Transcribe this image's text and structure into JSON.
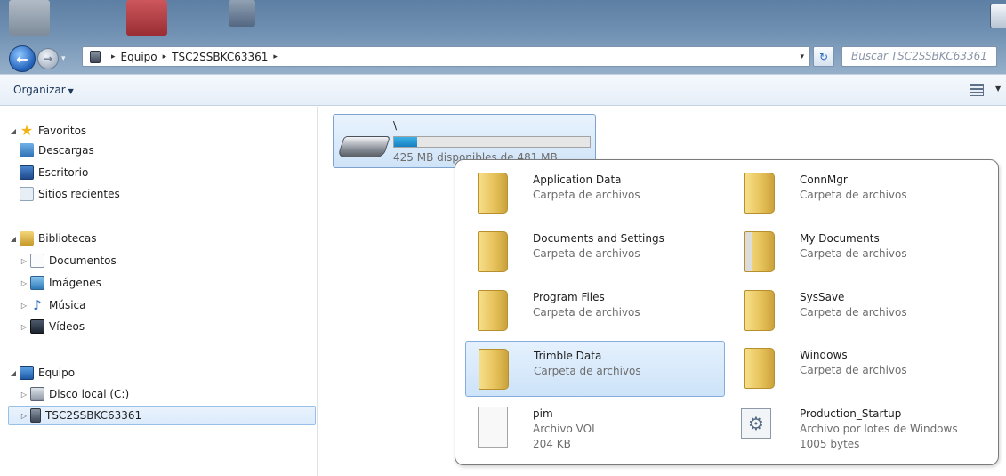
{
  "address_bar": {
    "crumbs": [
      "Equipo",
      "TSC2SSBKC63361"
    ],
    "search_placeholder": "Buscar TSC2SSBKC63361"
  },
  "toolbar": {
    "organize_label": "Organizar"
  },
  "nav_pane": {
    "favorites": {
      "label": "Favoritos",
      "items": [
        "Descargas",
        "Escritorio",
        "Sitios recientes"
      ]
    },
    "libraries": {
      "label": "Bibliotecas",
      "items": [
        "Documentos",
        "Imágenes",
        "Música",
        "Vídeos"
      ]
    },
    "computer": {
      "label": "Equipo",
      "items": [
        "Disco local (C:)",
        "TSC2SSBKC63361"
      ]
    }
  },
  "drive": {
    "name": "\\",
    "free_text": "425 MB disponibles de 481 MB",
    "used_fraction": 0.116
  },
  "popup_items": [
    {
      "name": "Application Data",
      "type": "Carpeta de archivos",
      "icon": "folder-icon"
    },
    {
      "name": "ConnMgr",
      "type": "Carpeta de archivos",
      "icon": "folder-icon"
    },
    {
      "name": "Documents and Settings",
      "type": "Carpeta de archivos",
      "icon": "folder-icon"
    },
    {
      "name": "My Documents",
      "type": "Carpeta de archivos",
      "icon": "documents-folder-icon"
    },
    {
      "name": "Program Files",
      "type": "Carpeta de archivos",
      "icon": "folder-icon"
    },
    {
      "name": "SysSave",
      "type": "Carpeta de archivos",
      "icon": "folder-icon"
    },
    {
      "name": "Trimble Data",
      "type": "Carpeta de archivos",
      "icon": "folder-icon",
      "selected": true
    },
    {
      "name": "Windows",
      "type": "Carpeta de archivos",
      "icon": "folder-icon"
    },
    {
      "name": "pim",
      "type": "Archivo VOL",
      "size": "204 KB",
      "icon": "file-icon"
    },
    {
      "name": "Production_Startup",
      "type": "Archivo por lotes de Windows",
      "size": "1005 bytes",
      "icon": "batch-file-icon"
    }
  ],
  "colors": {
    "title_gradient_top": "#5d7fa3",
    "selection_border": "#84acdd",
    "drive_fill": "#1680c2"
  }
}
